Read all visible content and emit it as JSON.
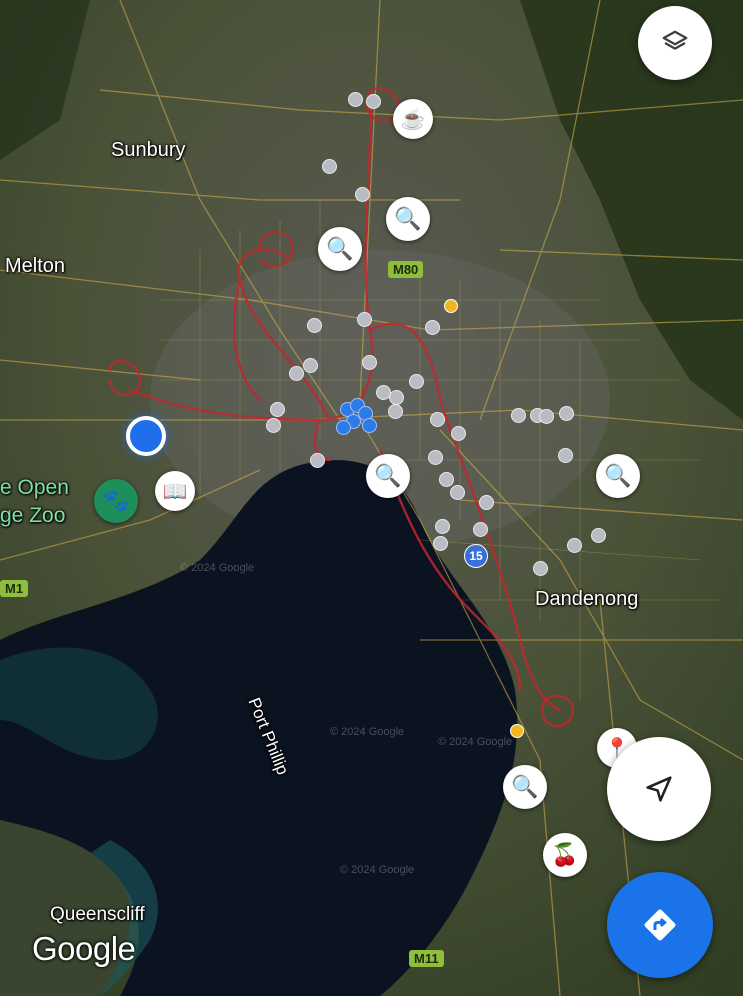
{
  "map": {
    "places": {
      "sunbury": "Sunbury",
      "melton": "Melton",
      "zoo_line1": "e Open",
      "zoo_line2": "ge Zoo",
      "dandenong": "Dandenong",
      "port_phillip": "Port Phillip",
      "queenscliff": "Queenscliff"
    },
    "shields": {
      "m80": "M80",
      "m1": "M1",
      "m11": "M11",
      "route15": "15"
    },
    "watermark": "© 2024 Google",
    "attribution": "Google"
  },
  "pois": [
    {
      "name": "coffee",
      "icon": "coffee-icon",
      "glyph": "☕"
    },
    {
      "name": "search-1",
      "icon": "magnifier-icon",
      "glyph": "🔍"
    },
    {
      "name": "search-2",
      "icon": "magnifier-icon",
      "glyph": "🔍"
    },
    {
      "name": "search-3",
      "icon": "magnifier-icon",
      "glyph": "🔍"
    },
    {
      "name": "search-4",
      "icon": "magnifier-icon",
      "glyph": "🔍"
    },
    {
      "name": "search-5",
      "icon": "magnifier-icon",
      "glyph": "🔍"
    },
    {
      "name": "zoo",
      "icon": "paw-icon",
      "glyph": "🐾"
    },
    {
      "name": "book",
      "icon": "book-icon",
      "glyph": "📖"
    },
    {
      "name": "cherry",
      "icon": "cherry-icon",
      "glyph": "🍒"
    },
    {
      "name": "pin",
      "icon": "map-pin-icon",
      "glyph": "📍"
    }
  ],
  "controls": {
    "layers_icon": "layers-icon",
    "navigate_icon": "navigation-arrow-icon",
    "directions_icon": "directions-icon"
  },
  "colors": {
    "track": "#c1272d",
    "my_location": "#1f6feb",
    "directions_fab": "#1a73e8",
    "visited_dot": "#b9bcc3",
    "yellow_dot": "#f2b623",
    "bay": "#0b1220"
  }
}
